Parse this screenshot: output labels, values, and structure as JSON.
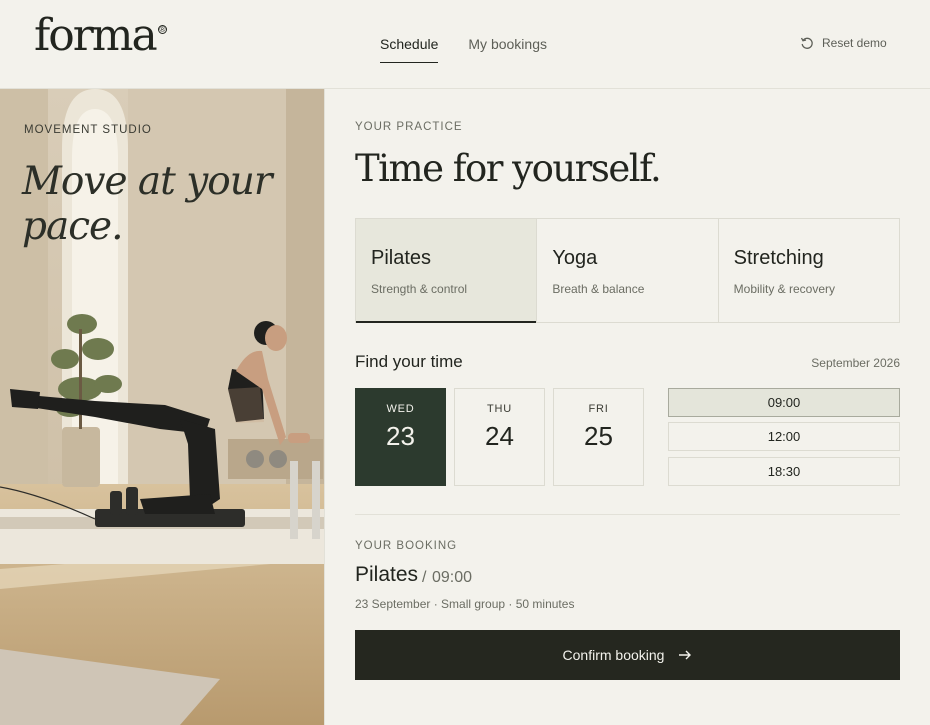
{
  "brand": {
    "logo": "forma",
    "registered": "®"
  },
  "nav": {
    "items": [
      {
        "label": "Schedule",
        "active": true
      },
      {
        "label": "My bookings",
        "active": false
      }
    ]
  },
  "reset": {
    "label": "Reset demo",
    "icon": "reset-icon"
  },
  "hero": {
    "eyebrow": "MOVEMENT STUDIO",
    "headline": "Move at your pace."
  },
  "practice": {
    "eyebrow": "YOUR PRACTICE",
    "title": "Time for yourself."
  },
  "classes": [
    {
      "name": "Pilates",
      "sub": "Strength & control",
      "selected": true
    },
    {
      "name": "Yoga",
      "sub": "Breath & balance",
      "selected": false
    },
    {
      "name": "Stretching",
      "sub": "Mobility & recovery",
      "selected": false
    }
  ],
  "find": {
    "title": "Find your time",
    "month": "September 2026"
  },
  "days": [
    {
      "weekday": "WED",
      "date": "23",
      "selected": true
    },
    {
      "weekday": "THU",
      "date": "24",
      "selected": false
    },
    {
      "weekday": "FRI",
      "date": "25",
      "selected": false
    }
  ],
  "times": [
    {
      "label": "09:00",
      "selected": true
    },
    {
      "label": "12:00",
      "selected": false
    },
    {
      "label": "18:30",
      "selected": false
    }
  ],
  "booking": {
    "eyebrow": "YOUR BOOKING",
    "class": "Pilates",
    "separator": "/",
    "time": "09:00",
    "details": "23 September · Small group · 50 minutes"
  },
  "confirm": {
    "label": "Confirm booking",
    "icon": "arrow-right-icon"
  },
  "colors": {
    "background": "#f3f2ec",
    "accent": "#2c3a2e",
    "text": "#22251f",
    "button": "#25271f"
  }
}
